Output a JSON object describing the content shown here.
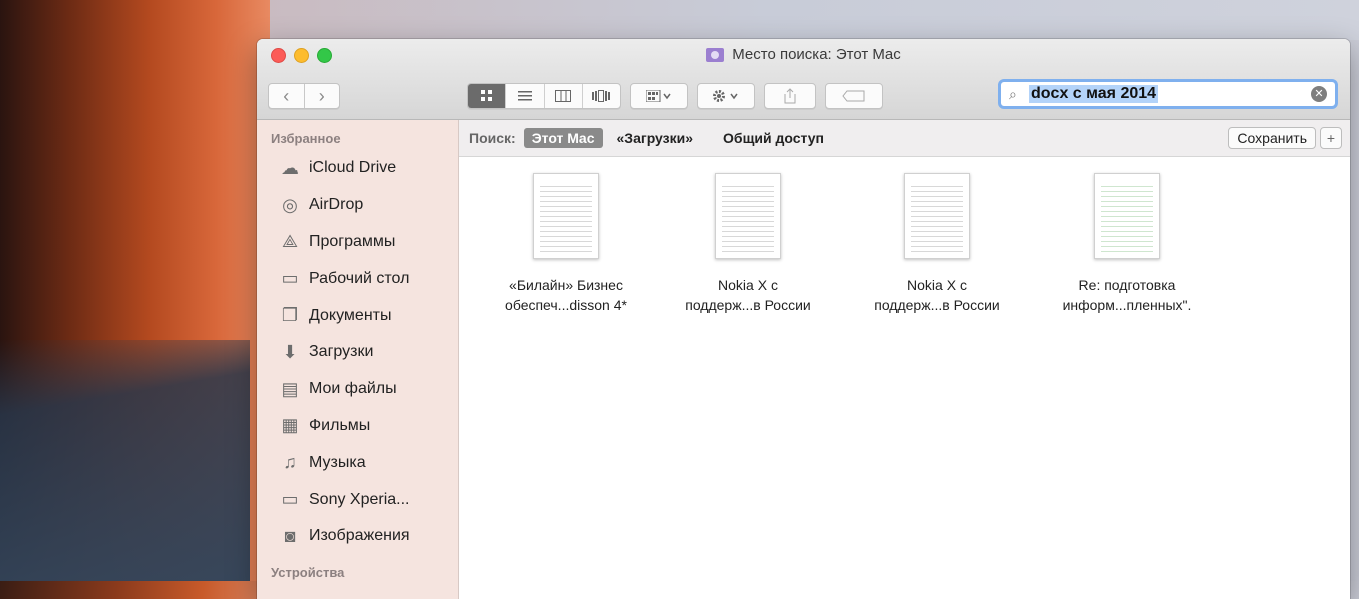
{
  "window": {
    "title": "Место поиска: Этот Mac"
  },
  "toolbar": {
    "back_glyph": "‹",
    "forward_glyph": "›",
    "view_modes": [
      "icons",
      "list",
      "columns",
      "cover-flow"
    ],
    "active_view": "icons",
    "search_value": "docx с мая 2014"
  },
  "sidebar": {
    "section_favorites": "Избранное",
    "items": [
      {
        "label": "iCloud Drive",
        "icon": "cloud-icon"
      },
      {
        "label": "AirDrop",
        "icon": "airdrop-icon"
      },
      {
        "label": "Программы",
        "icon": "applications-icon"
      },
      {
        "label": "Рабочий стол",
        "icon": "desktop-icon"
      },
      {
        "label": "Документы",
        "icon": "documents-icon"
      },
      {
        "label": "Загрузки",
        "icon": "downloads-icon"
      },
      {
        "label": "Мои файлы",
        "icon": "all-files-icon"
      },
      {
        "label": "Фильмы",
        "icon": "movies-icon"
      },
      {
        "label": "Музыка",
        "icon": "music-icon"
      },
      {
        "label": "Sony Xperia...",
        "icon": "folder-icon"
      },
      {
        "label": "Изображения",
        "icon": "camera-icon"
      }
    ],
    "section_devices": "Устройства"
  },
  "scope": {
    "label": "Поиск:",
    "this_mac": "Этот Mac",
    "downloads": "«Загрузки»",
    "shared": "Общий доступ",
    "save": "Сохранить",
    "add": "+"
  },
  "files": [
    {
      "line1": "«Билайн» Бизнес",
      "line2": "обеспеч...disson 4*"
    },
    {
      "line1": "Nokia X с",
      "line2": "поддерж...в России"
    },
    {
      "line1": "Nokia X с",
      "line2": "поддерж...в России"
    },
    {
      "line1": "Re: подготовка",
      "line2": "информ...пленных\"."
    }
  ]
}
